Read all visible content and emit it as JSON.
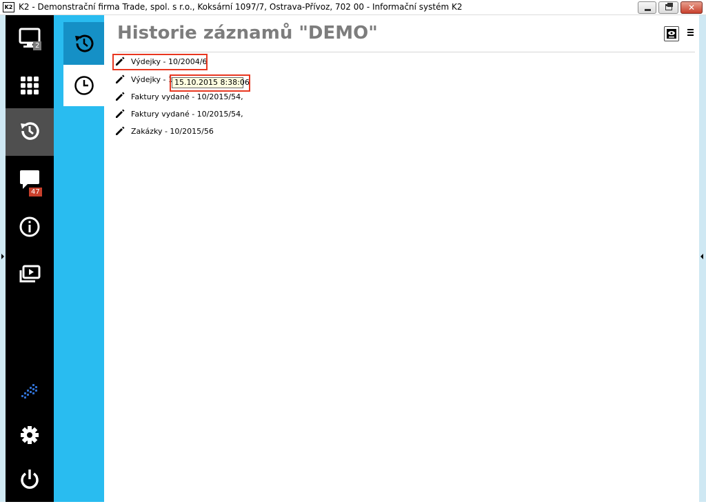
{
  "window": {
    "icon_text": "K2",
    "title": "K2 - Demonstrační firma Trade, spol. s r.o., Koksární 1097/7, Ostrava-Přívoz, 702 00 - Informační systém K2"
  },
  "rail": {
    "desktop_badge": "2",
    "messages_badge": "47",
    "items": [
      "monitor-icon",
      "apps-grid-icon",
      "history-icon",
      "messages-icon",
      "info-icon",
      "media-icon",
      "k2-logo-icon",
      "gear-icon",
      "power-icon"
    ],
    "active_item": "history-icon"
  },
  "page": {
    "title": "Historie záznamů \"DEMO\""
  },
  "history": {
    "items": [
      {
        "label": "Výdejky - 10/2004/6"
      },
      {
        "label": "Výdejky - 1"
      },
      {
        "label": "Faktury vydané - 10/2015/54,"
      },
      {
        "label": "Faktury vydané - 10/2015/54,"
      },
      {
        "label": "Zakázky - 10/2015/56"
      }
    ]
  },
  "tooltip": {
    "text": "15.10.2015 8:38:06"
  },
  "colors": {
    "rail": "#000000",
    "rail_active": "#4f4f4f",
    "subpanel": "#29bcf0",
    "subpanel_active": "#1590c6",
    "highlight": "#e8361f",
    "badge_red": "#c8402c"
  }
}
